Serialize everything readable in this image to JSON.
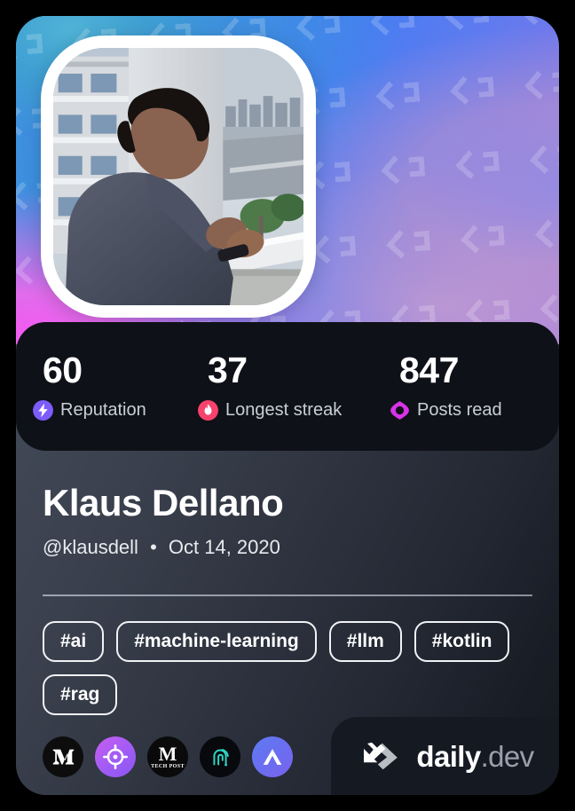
{
  "card": {
    "cover": {
      "gradient_colors": [
        "#49b0d8",
        "#3e83ef",
        "#7878e8",
        "#a07de0",
        "#f25bf0"
      ],
      "watermark": "daily-dev-chevron-pattern"
    },
    "avatar": {
      "alt": "Portrait of a man leaning on a balcony railing with city skyline"
    }
  },
  "stats": [
    {
      "value": "60",
      "label": "Reputation",
      "icon": "reputation-bolt-icon",
      "color": "#7c5cfa"
    },
    {
      "value": "37",
      "label": "Longest streak",
      "icon": "streak-flame-icon",
      "color": "#f7426e"
    },
    {
      "value": "847",
      "label": "Posts read",
      "icon": "posts-read-eye-icon",
      "color": "#d733e8"
    }
  ],
  "profile": {
    "name": "Klaus Dellano",
    "handle": "@klausdell",
    "separator": "•",
    "joined_date": "Oct 14, 2020"
  },
  "tags": [
    {
      "label": "#ai"
    },
    {
      "label": "#machine-learning"
    },
    {
      "label": "#llm"
    },
    {
      "label": "#kotlin"
    },
    {
      "label": "#rag"
    }
  ],
  "badges": [
    {
      "name": "medium-badge",
      "icon": "medium-m-icon",
      "title": "Medium"
    },
    {
      "name": "target-badge",
      "icon": "crosshair-icon",
      "title": "Target"
    },
    {
      "name": "techpost-badge",
      "icon": "m-tech-post-icon",
      "title": "M Tech Post",
      "text_top": "M",
      "text_bottom": "TECH POST"
    },
    {
      "name": "arc-badge",
      "icon": "teal-arc-icon",
      "title": "Arc"
    },
    {
      "name": "ai-badge",
      "icon": "letter-a-icon",
      "title": "A"
    }
  ],
  "brand": {
    "mark": "daily-dev-chevron-mark",
    "name_primary": "daily",
    "name_secondary": ".dev"
  }
}
